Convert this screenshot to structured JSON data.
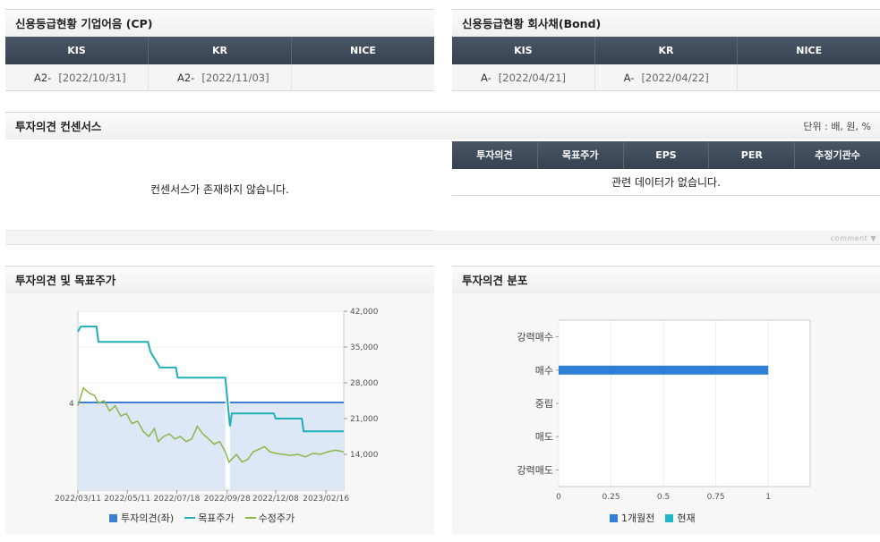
{
  "cp": {
    "title": "신용등급현황 기업어음 (CP)",
    "headers": [
      "KIS",
      "KR",
      "NICE"
    ],
    "ratings": [
      {
        "grade": "A2-",
        "date": "[2022/10/31]"
      },
      {
        "grade": "A2-",
        "date": "[2022/11/03]"
      },
      {
        "grade": "",
        "date": ""
      }
    ]
  },
  "bond": {
    "title": "신용등급현황 회사채(Bond)",
    "headers": [
      "KIS",
      "KR",
      "NICE"
    ],
    "ratings": [
      {
        "grade": "A-",
        "date": "[2022/04/21]"
      },
      {
        "grade": "A-",
        "date": "[2022/04/22]"
      },
      {
        "grade": "",
        "date": ""
      }
    ]
  },
  "consensus": {
    "title": "투자의견 컨센서스",
    "unit": "단위 : 배, 원, %",
    "empty_message": "컨센서스가 존재하지 않습니다.",
    "headers": [
      "투자의견",
      "목표주가",
      "EPS",
      "PER",
      "추정기관수"
    ],
    "table_empty": "관련 데이터가 없습니다.",
    "comment_label": "comment"
  },
  "opinion_price": {
    "title": "투자의견 및 목표주가",
    "colors": {
      "opinion": "#3a7fd0",
      "target": "#20b0b8",
      "price": "#8ab84a",
      "fill": "#dde7f5"
    },
    "chart_data": {
      "type": "line",
      "x_ticks": [
        "2022/03/11",
        "2022/05/11",
        "2022/07/18",
        "2022/09/28",
        "2022/12/08",
        "2023/02/16"
      ],
      "y_left_ticks": [
        "4"
      ],
      "y_right_ticks": [
        "42,000",
        "35,000",
        "28,000",
        "21,000",
        "14,000"
      ],
      "y_right_range": [
        7000,
        42000
      ],
      "series": [
        {
          "name": "투자의견(좌)",
          "kind": "bar",
          "values": [
            4,
            4
          ]
        },
        {
          "name": "목표주가",
          "kind": "step",
          "points": [
            [
              0,
              38000
            ],
            [
              3,
              39000
            ],
            [
              20,
              39000
            ],
            [
              22,
              36000
            ],
            [
              75,
              36000
            ],
            [
              78,
              34000
            ],
            [
              88,
              31000
            ],
            [
              105,
              31000
            ],
            [
              107,
              29000
            ],
            [
              158,
              29000
            ],
            [
              163,
              19500
            ],
            [
              165,
              22000
            ],
            [
              210,
              22000
            ],
            [
              212,
              21000
            ],
            [
              240,
              21000
            ],
            [
              242,
              18500
            ],
            [
              285,
              18500
            ]
          ]
        },
        {
          "name": "수정주가",
          "kind": "line",
          "points": [
            [
              0,
              23500
            ],
            [
              6,
              27000
            ],
            [
              12,
              26000
            ],
            [
              18,
              25500
            ],
            [
              22,
              24000
            ],
            [
              28,
              24500
            ],
            [
              34,
              22500
            ],
            [
              40,
              23500
            ],
            [
              46,
              21500
            ],
            [
              52,
              22000
            ],
            [
              58,
              20000
            ],
            [
              64,
              20500
            ],
            [
              70,
              18500
            ],
            [
              76,
              17500
            ],
            [
              82,
              19000
            ],
            [
              86,
              16500
            ],
            [
              92,
              17500
            ],
            [
              98,
              18000
            ],
            [
              104,
              17000
            ],
            [
              110,
              17500
            ],
            [
              116,
              16500
            ],
            [
              122,
              17000
            ],
            [
              128,
              19500
            ],
            [
              134,
              18000
            ],
            [
              140,
              17000
            ],
            [
              146,
              16000
            ],
            [
              152,
              16500
            ],
            [
              158,
              14500
            ],
            [
              162,
              12500
            ],
            [
              170,
              14000
            ],
            [
              176,
              12500
            ],
            [
              182,
              13000
            ],
            [
              188,
              14500
            ],
            [
              194,
              15000
            ],
            [
              200,
              15500
            ],
            [
              206,
              14500
            ],
            [
              212,
              14200
            ],
            [
              220,
              14000
            ],
            [
              228,
              13800
            ],
            [
              236,
              14000
            ],
            [
              244,
              13500
            ],
            [
              252,
              14200
            ],
            [
              260,
              14000
            ],
            [
              268,
              14500
            ],
            [
              276,
              14800
            ],
            [
              285,
              14500
            ]
          ]
        }
      ]
    },
    "legend": [
      "투자의견(좌)",
      "목표주가",
      "수정주가"
    ]
  },
  "distribution": {
    "title": "투자의견 분포",
    "colors": {
      "prev": "#2f7fd6",
      "now": "#1fb6c6"
    },
    "chart_data": {
      "type": "bar",
      "orientation": "horizontal",
      "categories": [
        "강력매수",
        "매수",
        "중립",
        "매도",
        "강력매도"
      ],
      "series": [
        {
          "name": "1개월전",
          "values": [
            0,
            1,
            0,
            0,
            0
          ]
        },
        {
          "name": "현재",
          "values": [
            0,
            0,
            0,
            0,
            0
          ]
        }
      ],
      "x_ticks": [
        "0",
        "0.25",
        "0.5",
        "0.75",
        "1"
      ],
      "xlim": [
        0,
        1.2
      ]
    },
    "legend": [
      "1개월전",
      "현재"
    ]
  }
}
